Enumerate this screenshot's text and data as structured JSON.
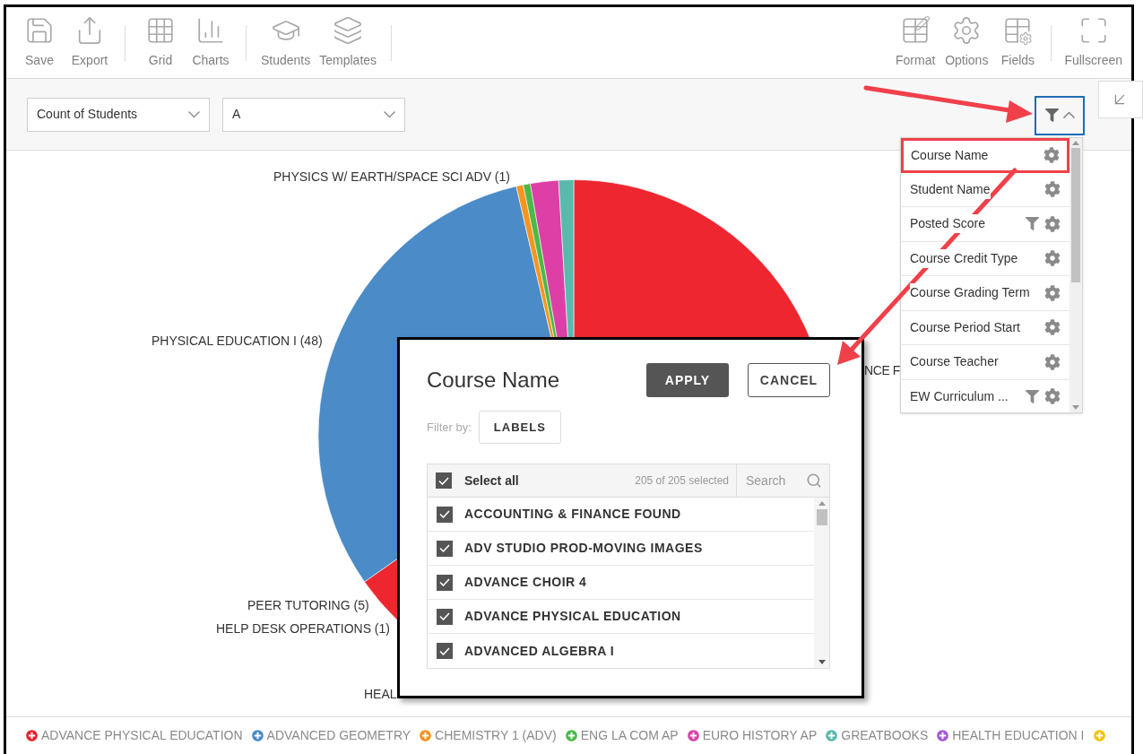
{
  "toolbar": {
    "left_groups": [
      [
        {
          "kind": "save",
          "label": "Save"
        },
        {
          "kind": "export",
          "label": "Export"
        }
      ],
      [
        {
          "kind": "grid",
          "label": "Grid"
        },
        {
          "kind": "charts",
          "label": "Charts"
        }
      ],
      [
        {
          "kind": "students",
          "label": "Students"
        },
        {
          "kind": "templates",
          "label": "Templates"
        }
      ]
    ],
    "right_groups": [
      [
        {
          "kind": "format",
          "label": "Format"
        },
        {
          "kind": "options",
          "label": "Options"
        },
        {
          "kind": "fields",
          "label": "Fields"
        }
      ],
      [
        {
          "kind": "fullscreen",
          "label": "Fullscreen"
        }
      ]
    ]
  },
  "selectors": [
    {
      "value": "Count of Students"
    },
    {
      "value": "A"
    }
  ],
  "filter_button": {
    "active": true
  },
  "chart": {
    "labels": [
      {
        "text": "PHYSICS W/ EARTH/SPACE SCI ADV (1)"
      },
      {
        "text": "PHYSICAL EDUCATION I (48)"
      },
      {
        "text": "PEER TUTORING (5)"
      },
      {
        "text": "HELP DESK OPERATIONS (1)"
      },
      {
        "text": "HEAL"
      },
      {
        "text": "NCE F"
      }
    ]
  },
  "field_list": {
    "items": [
      {
        "name": "Course Name",
        "filtered": false,
        "highlighted": true
      },
      {
        "name": "Student Name",
        "filtered": false,
        "highlighted": false
      },
      {
        "name": "Posted Score",
        "filtered": true,
        "highlighted": false
      },
      {
        "name": "Course Credit Type",
        "filtered": false,
        "highlighted": false
      },
      {
        "name": "Course Grading Term",
        "filtered": false,
        "highlighted": false
      },
      {
        "name": "Course Period Start",
        "filtered": false,
        "highlighted": false
      },
      {
        "name": "Course Teacher",
        "filtered": false,
        "highlighted": false
      },
      {
        "name": "EW Curriculum ...",
        "filtered": true,
        "highlighted": false
      }
    ]
  },
  "filter_dialog": {
    "title": "Course Name",
    "apply": "APPLY",
    "cancel": "CANCEL",
    "filter_by_label": "Filter by:",
    "filter_by_value": "LABELS",
    "select_all": {
      "label": "Select all",
      "checked": true
    },
    "count": "205 of 205 selected",
    "search": {
      "placeholder": "Search"
    },
    "items": [
      {
        "label": "ACCOUNTING & FINANCE FOUND",
        "checked": true
      },
      {
        "label": "ADV STUDIO PROD-MOVING IMAGES",
        "checked": true
      },
      {
        "label": "ADVANCE CHOIR 4",
        "checked": true
      },
      {
        "label": "ADVANCE PHYSICAL EDUCATION",
        "checked": true
      },
      {
        "label": "ADVANCED ALGEBRA I",
        "checked": true
      }
    ]
  },
  "legend": [
    {
      "label": "ADVANCE PHYSICAL EDUCATION",
      "color": "#e8232d"
    },
    {
      "label": "ADVANCED GEOMETRY",
      "color": "#4a8bc8"
    },
    {
      "label": "CHEMISTRY 1 (ADV)",
      "color": "#f7941d"
    },
    {
      "label": "ENG LA COM AP",
      "color": "#4cb848"
    },
    {
      "label": "EURO HISTORY AP",
      "color": "#dd3fa7"
    },
    {
      "label": "GREATBOOKS",
      "color": "#5ab9ab"
    },
    {
      "label": "HEALTH EDUCATION I",
      "color": "#a35ad6"
    },
    {
      "color": "#f2c500"
    }
  ]
}
